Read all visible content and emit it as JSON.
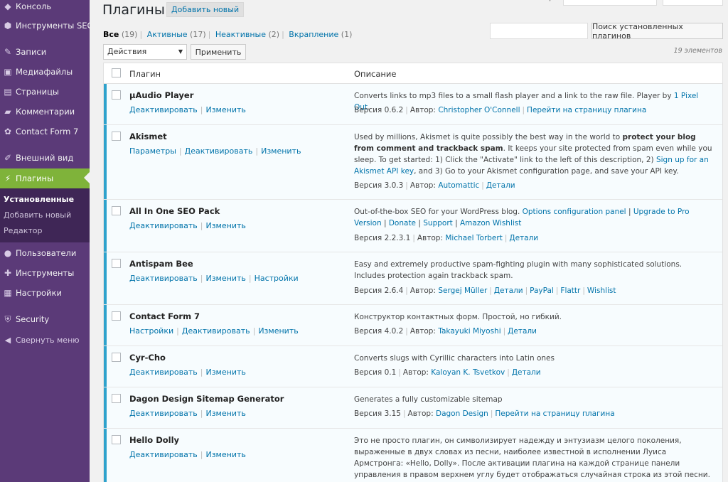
{
  "sidebar": {
    "items": [
      {
        "label": "Консоль",
        "icon": "dashboard-icon",
        "glyph": "◆",
        "key": "console"
      },
      {
        "label": "Инструменты SEO",
        "icon": "seo-icon",
        "glyph": "⬢",
        "key": "seo"
      },
      {
        "label": "Записи",
        "icon": "pin-icon",
        "glyph": "✎",
        "key": "posts"
      },
      {
        "label": "Медиафайлы",
        "icon": "media-icon",
        "glyph": "▣",
        "key": "media"
      },
      {
        "label": "Страницы",
        "icon": "pages-icon",
        "glyph": "▤",
        "key": "pages"
      },
      {
        "label": "Комментарии",
        "icon": "comments-icon",
        "glyph": "▰",
        "key": "comments"
      },
      {
        "label": "Contact Form 7",
        "icon": "contact-form-icon",
        "glyph": "✿",
        "key": "cf7"
      },
      {
        "label": "Внешний вид",
        "icon": "appearance-icon",
        "glyph": "✐",
        "key": "appearance"
      },
      {
        "label": "Плагины",
        "icon": "plugins-icon",
        "glyph": "⚡",
        "key": "plugins"
      },
      {
        "label": "Пользователи",
        "icon": "users-icon",
        "glyph": "●",
        "key": "users"
      },
      {
        "label": "Инструменты",
        "icon": "tools-icon",
        "glyph": "✚",
        "key": "tools"
      },
      {
        "label": "Настройки",
        "icon": "settings-icon",
        "glyph": "▦",
        "key": "settings"
      },
      {
        "label": "Security",
        "icon": "shield-icon",
        "glyph": "⛨",
        "key": "security"
      }
    ],
    "submenu": [
      "Установленные",
      "Добавить новый",
      "Редактор"
    ],
    "collapse_label": "Свернуть меню",
    "collapse_glyph": "◀"
  },
  "header": {
    "title": "Плагины",
    "add_new": "Добавить новый"
  },
  "filters": [
    {
      "label": "Все",
      "count": "(19)"
    },
    {
      "label": "Активные",
      "count": "(17)"
    },
    {
      "label": "Неактивные",
      "count": "(2)"
    },
    {
      "label": "Вкрапление",
      "count": "(1)"
    }
  ],
  "search": {
    "button": "Поиск установленных плагинов",
    "value": ""
  },
  "bulk": {
    "selected": "Действия",
    "apply": "Применить",
    "arrow": "▼"
  },
  "items_count": "19 элементов",
  "table": {
    "col_plugin": "Плагин",
    "col_description": "Описание",
    "rows": [
      {
        "name": "µAudio Player",
        "actions": [
          "Деактивировать",
          "Изменить"
        ],
        "desc": "Converts links to mp3 files to a small flash player and a link to the raw file. Player by ",
        "desc_link": "1 Pixel Out",
        "desc_end": ".",
        "version": "Версия 0.6.2",
        "author_label": "Автор:",
        "author": "Christopher O'Connell",
        "links": [
          "Перейти на страницу плагина"
        ]
      },
      {
        "name": "Akismet",
        "actions": [
          "Параметры",
          "Деактивировать",
          "Изменить"
        ],
        "desc_a": "Used by millions, Akismet is quite possibly the best way in the world to ",
        "desc_b": "protect your blog from comment and trackback spam",
        "desc_c": ". It keeps your site protected from spam even while you sleep. To get started: 1) Click the \"Activate\" link to the left of this description, 2) ",
        "desc_link": "Sign up for an Akismet API key",
        "desc_d": ", and 3) Go to your Akismet configuration page, and save your API key.",
        "version": "Версия 3.0.3",
        "author_label": "Автор:",
        "author": "Automattic",
        "links": [
          "Детали"
        ]
      },
      {
        "name": "All In One SEO Pack",
        "actions": [
          "Деактивировать",
          "Изменить"
        ],
        "desc": "Out-of-the-box SEO for your WordPress blog. ",
        "desc_links": [
          "Options configuration panel",
          "Upgrade to Pro Version",
          "Donate",
          "Support",
          "Amazon Wishlist"
        ],
        "version": "Версия 2.2.3.1",
        "author_label": "Автор:",
        "author": "Michael Torbert",
        "links": [
          "Детали"
        ]
      },
      {
        "name": "Antispam Bee",
        "actions": [
          "Деактивировать",
          "Изменить",
          "Настройки"
        ],
        "desc": "Easy and extremely productive spam-fighting plugin with many sophisticated solutions. Includes protection again trackback spam.",
        "version": "Версия 2.6.4",
        "author_label": "Автор:",
        "author": "Sergej Müller",
        "links": [
          "Детали",
          "PayPal",
          "Flattr",
          "Wishlist"
        ]
      },
      {
        "name": "Contact Form 7",
        "actions": [
          "Настройки",
          "Деактивировать",
          "Изменить"
        ],
        "desc": "Конструктор контактных форм. Простой, но гибкий.",
        "version": "Версия 4.0.2",
        "author_label": "Автор:",
        "author": "Takayuki Miyoshi",
        "links": [
          "Детали"
        ]
      },
      {
        "name": "Cyr-Cho",
        "actions": [
          "Деактивировать",
          "Изменить"
        ],
        "desc": "Converts slugs with Cyrillic characters into Latin ones",
        "version": "Версия 0.1",
        "author_label": "Автор:",
        "author": "Kaloyan K. Tsvetkov",
        "links": [
          "Детали"
        ]
      },
      {
        "name": "Dagon Design Sitemap Generator",
        "actions": [
          "Деактивировать",
          "Изменить"
        ],
        "desc": "Generates a fully customizable sitemap",
        "version": "Версия 3.15",
        "author_label": "Автор:",
        "author": "Dagon Design",
        "links": [
          "Перейти на страницу плагина"
        ]
      },
      {
        "name": "Hello Dolly",
        "actions": [
          "Деактивировать",
          "Изменить"
        ],
        "desc": "Это не просто плагин, он символизирует надежду и энтузиазм целого поколения, выраженные в двух словах из песни, наиболее известной в исполнении Луиса Армстронга: «Hello, Dolly». После активации плагина на каждой странице панели управления в правом верхнем углу будет отображаться случайная строка из этой песни."
      }
    ]
  },
  "colors": {
    "sidebar": "#5b3a78",
    "active_menu": "#7fb33a",
    "active_plugin_bar": "#2ea2cc",
    "link": "#0073aa"
  }
}
